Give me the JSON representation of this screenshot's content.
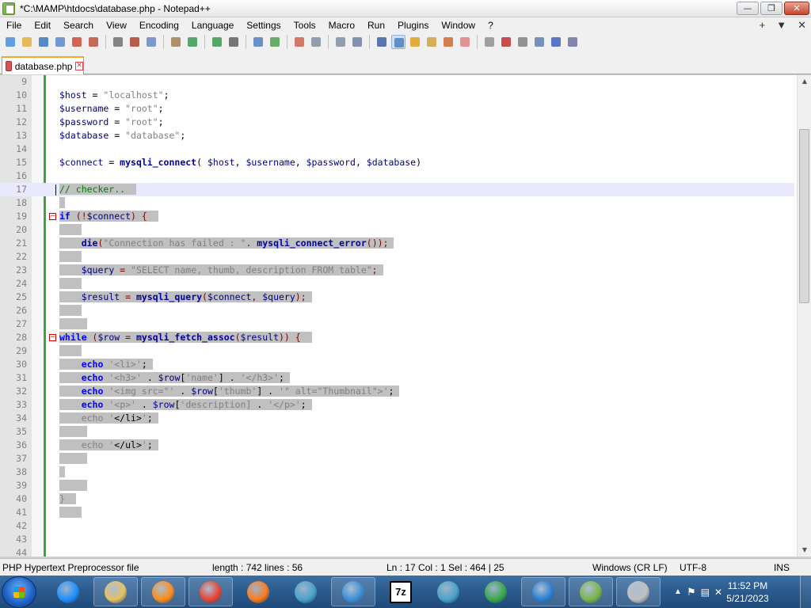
{
  "window": {
    "title": "*C:\\MAMP\\htdocs\\database.php - Notepad++",
    "minimize": "—",
    "maximize": "❐",
    "close": "✕"
  },
  "menu": {
    "items": [
      "File",
      "Edit",
      "Search",
      "View",
      "Encoding",
      "Language",
      "Settings",
      "Tools",
      "Macro",
      "Run",
      "Plugins",
      "Window",
      "?"
    ],
    "right": [
      "+",
      "▼",
      "✕"
    ]
  },
  "toolbar": {
    "icons": [
      "new-file-icon",
      "open-file-icon",
      "save-icon",
      "save-all-icon",
      "close-icon",
      "close-all-icon",
      "print-icon",
      "cut-icon",
      "copy-icon",
      "paste-icon",
      "undo-icon",
      "redo-icon",
      "find-icon",
      "replace-icon",
      "zoom-in-icon",
      "zoom-out-icon",
      "sync-v-icon",
      "sync-h-icon",
      "word-wrap-icon",
      "show-all-chars-icon",
      "indent-guide-icon",
      "udl-icon",
      "doc-map-icon",
      "function-list-icon",
      "folder-workspace-icon",
      "monitoring-icon",
      "record-macro-icon",
      "stop-macro-icon",
      "play-macro-icon",
      "run-macro-multiple-icon",
      "save-macro-icon"
    ]
  },
  "tab": {
    "label": "database.php",
    "close": "✕"
  },
  "editor": {
    "lines": [
      {
        "n": "9",
        "html": ""
      },
      {
        "n": "10",
        "html": "<span class='var'>$host</span><span class='plain'> = </span><span class='str'>\"localhost\"</span><span class='plain'>;</span>"
      },
      {
        "n": "11",
        "html": "<span class='var'>$username</span><span class='plain'> = </span><span class='str'>\"root\"</span><span class='plain'>;</span>"
      },
      {
        "n": "12",
        "html": "<span class='var'>$password</span><span class='plain'> = </span><span class='str'>\"root\"</span><span class='plain'>;</span>"
      },
      {
        "n": "13",
        "html": "<span class='var'>$database</span><span class='plain'> = </span><span class='str'>\"database\"</span><span class='plain'>;</span>"
      },
      {
        "n": "14",
        "html": ""
      },
      {
        "n": "15",
        "html": "<span class='var'>$connect</span><span class='plain'> = </span><span class='fn'>mysqli_connect</span><span class='plain'>( </span><span class='var'>$host</span><span class='plain'>, </span><span class='var'>$username</span><span class='plain'>, </span><span class='var'>$password</span><span class='plain'>, </span><span class='var'>$database</span><span class='plain'>)</span>"
      },
      {
        "n": "16",
        "html": ""
      },
      {
        "n": "17",
        "html": "<span class='sel'><span class='cmt'>// checker..  </span></span>",
        "current": true
      },
      {
        "n": "18",
        "html": "<span class='sel'> </span>"
      },
      {
        "n": "19",
        "html": "<span class='sel'><span class='kw'>if</span><span class='op'> (!</span><span class='var'>$connect</span><span class='op'>) {  </span></span>",
        "fold": true
      },
      {
        "n": "20",
        "html": "<span class='sel'>    </span>"
      },
      {
        "n": "21",
        "html": "<span class='sel'>    <span class='fn'>die</span><span class='op'>(</span><span class='str'>\"Connection has failed : \"</span><span class='op'>. </span><span class='fn'>mysqli_connect_error</span><span class='op'>()); </span></span>"
      },
      {
        "n": "22",
        "html": "<span class='sel'>    </span>"
      },
      {
        "n": "23",
        "html": "<span class='sel'>    <span class='var'>$query</span><span class='op'> = </span><span class='str'>\"SELECT name, thumb, description FROM table\"</span><span class='op'>; </span></span>"
      },
      {
        "n": "24",
        "html": "<span class='sel'>    </span>"
      },
      {
        "n": "25",
        "html": "<span class='sel'>    <span class='var'>$result</span><span class='op'> = </span><span class='fn'>mysqli_query</span><span class='op'>(</span><span class='var'>$connect</span><span class='op'>, </span><span class='var'>$query</span><span class='op'>); </span></span>"
      },
      {
        "n": "26",
        "html": "<span class='sel'>    </span>"
      },
      {
        "n": "27",
        "html": "<span class='sel'>     </span>"
      },
      {
        "n": "28",
        "html": "<span class='sel'><span class='kw'>while</span><span class='op'> (</span><span class='var'>$row</span><span class='op'> = </span><span class='fn'>mysqli_fetch_assoc</span><span class='op'>(</span><span class='var'>$result</span><span class='op'>)) {  </span></span>",
        "fold": true
      },
      {
        "n": "29",
        "html": "<span class='sel'>    </span>"
      },
      {
        "n": "30",
        "html": "<span class='sel'>    <span class='kw'>echo</span><span class='plain'> </span><span class='str'>'&lt;li&gt;'</span><span class='plain'>; </span></span>"
      },
      {
        "n": "31",
        "html": "<span class='sel'>    <span class='kw'>echo</span><span class='plain'> </span><span class='str'>'&lt;h3&gt;'</span><span class='plain'> . </span><span class='var'>$row</span><span class='plain'>[</span><span class='str'>'name'</span><span class='plain'>] . </span><span class='str'>'&lt;/h3&gt;'</span><span class='plain'>; </span></span>"
      },
      {
        "n": "32",
        "html": "<span class='sel'>    <span class='kw'>echo</span><span class='plain'> </span><span class='str'>'&lt;img src=\"'</span><span class='plain'> . </span><span class='var'>$row</span><span class='plain'>[</span><span class='str'>'thumb'</span><span class='plain'>] . </span><span class='str'>'\" alt=\"Thumbnail\"&gt;'</span><span class='plain'>; </span></span>"
      },
      {
        "n": "33",
        "html": "<span class='sel'>    <span class='kw'>echo</span><span class='plain'> </span><span class='str'>'&lt;p&gt;'</span><span class='plain'> . </span><span class='var'>$row</span><span class='plain'>[</span><span class='str'>'description]</span><span class='plain'> . </span><span class='str'>'&lt;/p&gt;'</span><span class='plain'>; </span></span>"
      },
      {
        "n": "34",
        "html": "<span class='sel'>    <span class='str'>echo '</span><span class='plain'>&lt;/li&gt;</span><span class='str'>'</span><span class='plain'>; </span></span>"
      },
      {
        "n": "35",
        "html": "<span class='sel'>     </span>"
      },
      {
        "n": "36",
        "html": "<span class='sel'>    <span class='str'>echo '</span><span class='plain'>&lt;/ul&gt;</span><span class='str'>'</span><span class='plain'>; </span></span>"
      },
      {
        "n": "37",
        "html": "<span class='sel'>     </span>"
      },
      {
        "n": "38",
        "html": "<span class='sel'> </span>"
      },
      {
        "n": "39",
        "html": "<span class='sel'>     </span>"
      },
      {
        "n": "40",
        "html": "<span class='sel'><span class='str'>}</span>  </span>"
      },
      {
        "n": "41",
        "html": "<span class='sel'>    </span>"
      },
      {
        "n": "42",
        "html": ""
      },
      {
        "n": "43",
        "html": ""
      },
      {
        "n": "44",
        "html": ""
      }
    ]
  },
  "statusbar": {
    "filetype": "PHP Hypertext Preprocessor file",
    "length": "length : 742    lines : 56",
    "position": "Ln : 17    Col : 1    Sel : 464 | 25",
    "eol": "Windows (CR LF)",
    "encoding": "UTF-8",
    "mode": "INS"
  },
  "taskbar": {
    "time": "11:52 PM",
    "date": "5/21/2023",
    "apps": [
      {
        "name": "internet-explorer-icon",
        "color": "#1e90ff",
        "open": false
      },
      {
        "name": "file-explorer-icon",
        "color": "#e8c060",
        "open": true
      },
      {
        "name": "media-player-icon",
        "color": "#ff8c1a",
        "open": true
      },
      {
        "name": "chrome-icon",
        "color": "#e84335",
        "open": true
      },
      {
        "name": "firefox-icon",
        "color": "#ff7a1a",
        "open": false
      },
      {
        "name": "mysql-workbench-icon",
        "color": "#4aa3c8",
        "open": false
      },
      {
        "name": "security-icon",
        "color": "#3c8fd6",
        "open": true
      },
      {
        "name": "7zip-icon",
        "color": "#ffffff",
        "open": false
      },
      {
        "name": "mysql-dolphin-icon",
        "color": "#4aa3c8",
        "open": false
      },
      {
        "name": "internet-download-icon",
        "color": "#3aa84a",
        "open": false
      },
      {
        "name": "network-icon",
        "color": "#2a7fd0",
        "open": true
      },
      {
        "name": "notepadpp-icon",
        "color": "#7ab648",
        "open": true
      },
      {
        "name": "mamp-icon",
        "color": "#c0c0c0",
        "open": true
      }
    ]
  }
}
